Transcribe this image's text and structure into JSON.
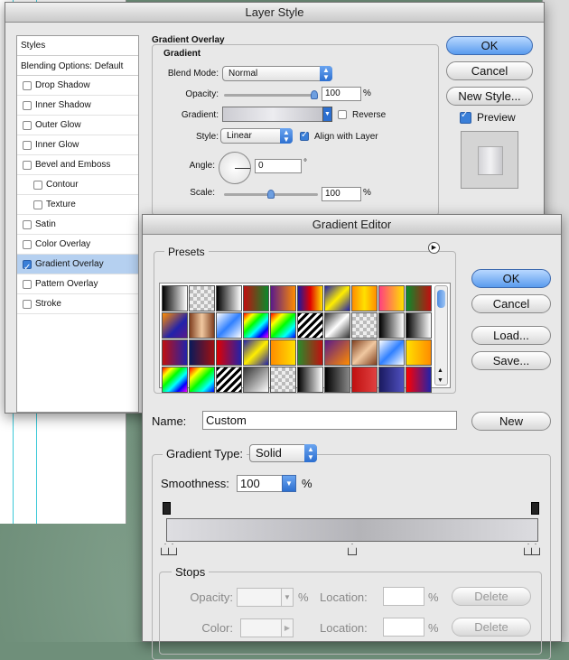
{
  "layer_style": {
    "title": "Layer Style",
    "styles_header": "Styles",
    "blending_options": "Blending Options: Default",
    "effects": [
      {
        "label": "Drop Shadow",
        "checked": false,
        "sub": false,
        "selected": false
      },
      {
        "label": "Inner Shadow",
        "checked": false,
        "sub": false,
        "selected": false
      },
      {
        "label": "Outer Glow",
        "checked": false,
        "sub": false,
        "selected": false
      },
      {
        "label": "Inner Glow",
        "checked": false,
        "sub": false,
        "selected": false
      },
      {
        "label": "Bevel and Emboss",
        "checked": false,
        "sub": false,
        "selected": false
      },
      {
        "label": "Contour",
        "checked": false,
        "sub": true,
        "selected": false
      },
      {
        "label": "Texture",
        "checked": false,
        "sub": true,
        "selected": false
      },
      {
        "label": "Satin",
        "checked": false,
        "sub": false,
        "selected": false
      },
      {
        "label": "Color Overlay",
        "checked": false,
        "sub": false,
        "selected": false
      },
      {
        "label": "Gradient Overlay",
        "checked": true,
        "sub": false,
        "selected": true
      },
      {
        "label": "Pattern Overlay",
        "checked": false,
        "sub": false,
        "selected": false
      },
      {
        "label": "Stroke",
        "checked": false,
        "sub": false,
        "selected": false
      }
    ],
    "section_title": "Gradient Overlay",
    "group_title": "Gradient",
    "blend_mode_label": "Blend Mode:",
    "blend_mode_value": "Normal",
    "opacity_label": "Opacity:",
    "opacity_value": "100",
    "opacity_unit": "%",
    "opacity_level": 1.0,
    "gradient_label": "Gradient:",
    "reverse_label": "Reverse",
    "style_label": "Style:",
    "style_value": "Linear",
    "align_label": "Align with Layer",
    "angle_label": "Angle:",
    "angle_value": "0",
    "angle_unit": "°",
    "scale_label": "Scale:",
    "scale_value": "100",
    "scale_unit": "%",
    "scale_level": 0.5,
    "ok": "OK",
    "cancel": "Cancel",
    "new_style": "New Style...",
    "preview_label": "Preview",
    "preview_checked": true
  },
  "gradient_editor": {
    "title": "Gradient Editor",
    "presets_label": "Presets",
    "presets_menu_icon": "circle-arrow-icon",
    "ok": "OK",
    "cancel": "Cancel",
    "load": "Load...",
    "save": "Save...",
    "name_label": "Name:",
    "name_value": "Custom",
    "new_button": "New",
    "gradient_type_label": "Gradient Type:",
    "gradient_type_value": "Solid",
    "smoothness_label": "Smoothness:",
    "smoothness_value": "100",
    "smoothness_unit": "%",
    "stops_label": "Stops",
    "opacity_label": "Opacity:",
    "opacity_unit": "%",
    "color_label": "Color:",
    "location_label": "Location:",
    "location_unit": "%",
    "delete_label": "Delete"
  },
  "preset_swatches": [
    "linear-gradient(90deg,#000,#fff)",
    "repeating-conic-gradient(#bbb 0 25%,#eee 0 50%) 0 0/8px 8px",
    "linear-gradient(90deg,#000,#fff)",
    "linear-gradient(90deg,#c01010,#0a8a2a)",
    "linear-gradient(90deg,#5a1a8a,#ff8c00)",
    "linear-gradient(90deg,#1a1aa0,#e00000,#ffe000)",
    "linear-gradient(135deg,#2222aa,#ffee00,#2222aa)",
    "linear-gradient(90deg,#ff8c00,#ffe000,#ff8c00)",
    "linear-gradient(90deg,#ff4080,#ffe000)",
    "linear-gradient(90deg,#0a8a2a,#c01010)",
    "linear-gradient(135deg,#ff8c00,#2222aa 60%,#5a1a8a)",
    "linear-gradient(90deg,#804020,#f0c8a0,#804020)",
    "linear-gradient(135deg,#fff,#3080ff,#fff)",
    "linear-gradient(135deg,#ff0000,#ffff00,#00ff00,#00ffff,#0000ff,#ff00ff)",
    "linear-gradient(135deg,#ff0000,#ffff00,#00ff00,#00ffff,#0000ff)",
    "repeating-linear-gradient(135deg,#000 0 3px,#fff 3px 6px)",
    "linear-gradient(135deg,#333,#fff,#333)",
    "repeating-conic-gradient(#bbb 0 25%,#eee 0 50%) 0 0/8px 8px",
    "linear-gradient(90deg,#000,#fff)",
    "linear-gradient(90deg,#000,#fff)",
    "linear-gradient(90deg,#c01010,#2222aa)",
    "linear-gradient(90deg,#0a1a5a,#a01010)",
    "linear-gradient(90deg,#e00000,#2222aa)",
    "linear-gradient(135deg,#2222aa,#ffee00,#2222aa)",
    "linear-gradient(90deg,#ff8c00,#ffe000)",
    "linear-gradient(90deg,#2a8a2a,#c01010)",
    "linear-gradient(135deg,#5a1a8a,#ff8c00)",
    "linear-gradient(135deg,#804020,#f0c8a0,#804020)",
    "linear-gradient(135deg,#fff,#3080ff,#fff)",
    "linear-gradient(90deg,#ffe000,#ff8c00)",
    "linear-gradient(135deg,#ff0000,#ffff00,#00ff00,#00ffff,#0000ff,#ff00ff)",
    "linear-gradient(135deg,#ff0000,#ffff00,#00ff00,#00ffff,#0000ff)",
    "repeating-linear-gradient(135deg,#000 0 3px,#fff 3px 6px)",
    "linear-gradient(135deg,#333,#fff)",
    "repeating-conic-gradient(#bbb 0 25%,#eee 0 50%) 0 0/8px 8px",
    "linear-gradient(90deg,#000,#fff)",
    "linear-gradient(90deg,#000,#888)",
    "linear-gradient(90deg,#c01010,#e04040)",
    "linear-gradient(90deg,#1a1a60,#5050c0)",
    "linear-gradient(90deg,#ff0000,#2222aa)"
  ],
  "colors": {
    "window_bg": "#e8e8e8",
    "selection": "#b5d0f0",
    "default_button": "#5a9bee",
    "guide": "#3ac8d8"
  }
}
